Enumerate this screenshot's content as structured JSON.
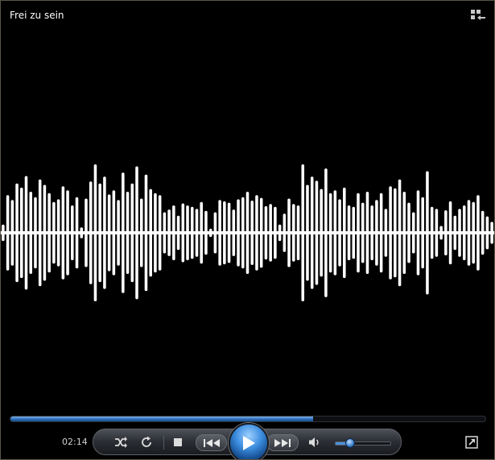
{
  "window": {
    "title": "Frei zu sein"
  },
  "icons": {
    "library": "switch-to-library-icon",
    "shuffle": "shuffle-icon",
    "repeat": "repeat-icon",
    "stop": "stop-icon",
    "previous": "previous-icon",
    "play": "play-icon",
    "next": "next-icon",
    "mute": "speaker-icon",
    "fullscreen": "fullscreen-icon"
  },
  "playback": {
    "elapsed": "02:14",
    "progress_fraction": 0.637,
    "volume_fraction": 0.26
  },
  "visualization": {
    "type": "bars-and-waves",
    "bar_heights": [
      0.12,
      0.55,
      0.48,
      0.72,
      0.66,
      0.83,
      0.6,
      0.52,
      0.78,
      0.7,
      0.58,
      0.45,
      0.49,
      0.68,
      0.62,
      0.4,
      0.52,
      0.08,
      0.5,
      0.75,
      1.0,
      0.72,
      0.82,
      0.56,
      0.62,
      0.48,
      0.88,
      0.6,
      0.72,
      0.97,
      0.5,
      0.85,
      0.64,
      0.58,
      0.55,
      0.3,
      0.34,
      0.4,
      0.25,
      0.43,
      0.4,
      0.38,
      0.35,
      0.45,
      0.32,
      0.06,
      0.3,
      0.48,
      0.46,
      0.44,
      0.34,
      0.49,
      0.52,
      0.6,
      0.47,
      0.55,
      0.51,
      0.39,
      0.42,
      0.38,
      0.12,
      0.28,
      0.5,
      0.42,
      0.4,
      1.0,
      0.7,
      0.82,
      0.76,
      0.64,
      0.94,
      0.58,
      0.62,
      0.49,
      0.66,
      0.4,
      0.38,
      0.58,
      0.44,
      0.6,
      0.4,
      0.48,
      0.58,
      0.35,
      0.68,
      0.65,
      0.78,
      0.6,
      0.44,
      0.3,
      0.62,
      0.52,
      0.9,
      0.38,
      0.35,
      0.1,
      0.33,
      0.46,
      0.25,
      0.35,
      0.4,
      0.48,
      0.45,
      0.55,
      0.32,
      0.24,
      0.16
    ]
  }
}
